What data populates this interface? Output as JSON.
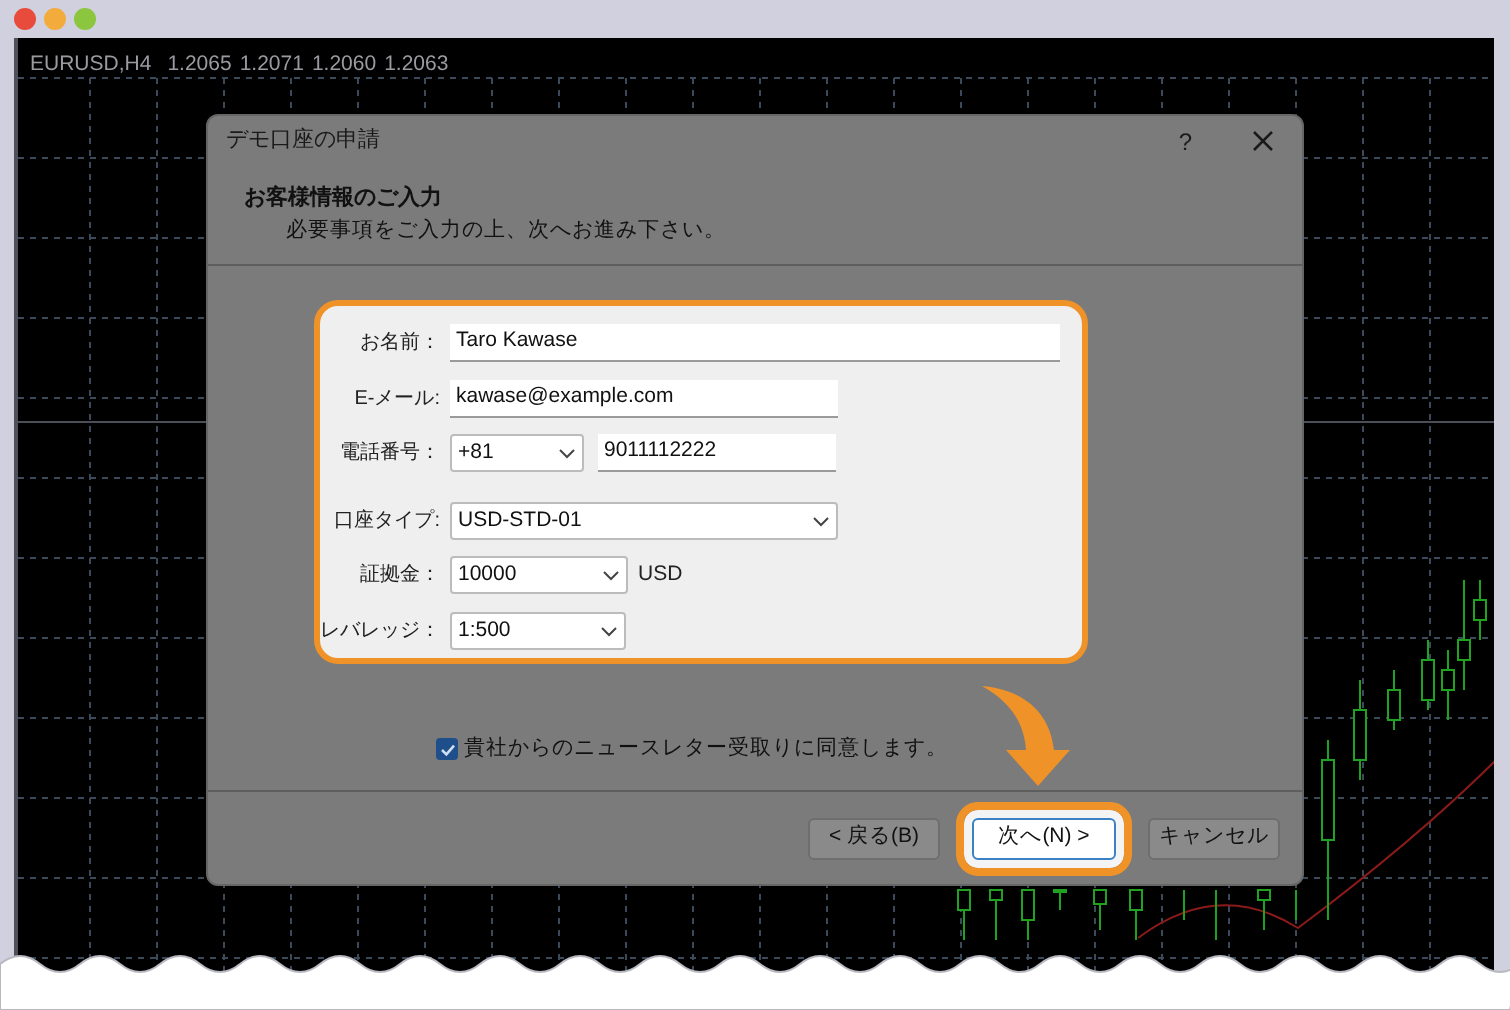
{
  "chart": {
    "symbol": "EURUSD,H4",
    "quotes": [
      "1.2065",
      "1.2071",
      "1.2060",
      "1.2063"
    ]
  },
  "dialog": {
    "title": "デモ口座の申請",
    "help": "?",
    "header": {
      "title": "お客様情報のご入力",
      "subtitle": "必要事項をご入力の上、次へお進み下さい。"
    },
    "form": {
      "highlighted": true,
      "fields": [
        {
          "label": "お名前：",
          "kind": "text",
          "value": "Taro Kawase"
        },
        {
          "label": "E-メール:",
          "kind": "text",
          "value": "kawase@example.com"
        },
        {
          "label": "電話番号：",
          "kind": "phone",
          "code": "+81",
          "number": "9011112222"
        },
        {
          "label": "口座タイプ:",
          "kind": "select",
          "value": "USD-STD-01"
        },
        {
          "label": "証拠金：",
          "kind": "select",
          "value": "10000",
          "unit": "USD"
        },
        {
          "label": "レバレッジ：",
          "kind": "select",
          "value": "1:500"
        }
      ]
    },
    "newsletter": {
      "label": "貴社からのニュースレター受取りに同意します。",
      "checked": true
    },
    "buttons": [
      {
        "label": "< 戻る(B)",
        "default": false,
        "highlighted": false
      },
      {
        "label": "次へ(N) >",
        "default": true,
        "highlighted": true
      },
      {
        "label": "キャンセル",
        "default": false,
        "highlighted": false
      }
    ]
  }
}
